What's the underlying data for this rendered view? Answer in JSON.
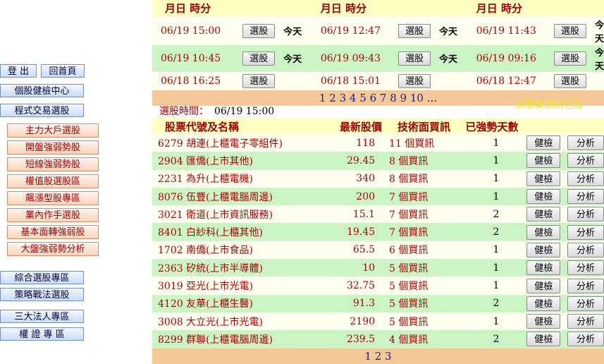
{
  "nav": {
    "top": [
      "登 出",
      "回首頁"
    ],
    "blue1": [
      "個股健檢中心",
      "程式交易選股"
    ],
    "red": [
      "主力大戶選股",
      "開盤強弱勢股",
      "短線強弱勢股",
      "權值股選股區",
      "飆漲型股專區",
      "業內作手選股",
      "基本面轉強弱股",
      "大盤強弱勢分析"
    ],
    "blue2": [
      "綜合選股專區",
      "策略戰法選股",
      "三大法人專區",
      "權 證 專 區"
    ]
  },
  "recent": {
    "header": "月日 時分",
    "pick_label": "選股",
    "rows": [
      [
        {
          "t": "06/19 15:00",
          "today": "今天"
        },
        {
          "t": "06/19 12:47",
          "today": "今天"
        },
        {
          "t": "06/19 11:43",
          "today": "今天"
        }
      ],
      [
        {
          "t": "06/19 10:45",
          "today": "今天"
        },
        {
          "t": "06/19 09:43",
          "today": "今天"
        },
        {
          "t": "06/19 09:16",
          "today": "今天"
        }
      ],
      [
        {
          "t": "06/18 16:25",
          "today": ""
        },
        {
          "t": "06/18 15:01",
          "today": ""
        },
        {
          "t": "06/18 12:47",
          "today": ""
        }
      ]
    ],
    "pages": [
      "1",
      "2",
      "3",
      "4",
      "5",
      "6",
      "7",
      "8",
      "9",
      "10",
      "..."
    ]
  },
  "main": {
    "industry_link": "依產業類別選股",
    "pick_time_label": "選股時間：",
    "pick_time_value": "06/19 15:00",
    "columns": [
      "股票代號及名稱",
      "最新股價",
      "技術面買訊",
      "已強勢天數"
    ],
    "btn_check": "健檢",
    "btn_analyze": "分析",
    "stocks": [
      {
        "name": "6279 胡連(上櫃電子零組件)",
        "price": "118",
        "signal": "11 個買訊",
        "days": "1"
      },
      {
        "name": "2904 匯僑(上市其他)",
        "price": "29.45",
        "signal": "8 個買訊",
        "days": "1"
      },
      {
        "name": "2231 為升(上櫃電機)",
        "price": "340",
        "signal": "8 個買訊",
        "days": "1"
      },
      {
        "name": "8076 伍豐(上櫃電腦周邊)",
        "price": "200",
        "signal": "7 個買訊",
        "days": "1"
      },
      {
        "name": "3021 衛道(上市資訊服務)",
        "price": "15.1",
        "signal": "7 個買訊",
        "days": "2"
      },
      {
        "name": "8401 白紗科(上櫃其他)",
        "price": "19.45",
        "signal": "7 個買訊",
        "days": "2"
      },
      {
        "name": "1702 南僑(上市食品)",
        "price": "65.5",
        "signal": "6 個買訊",
        "days": "1"
      },
      {
        "name": "2363 矽統(上市半導體)",
        "price": "10",
        "signal": "5 個買訊",
        "days": "1"
      },
      {
        "name": "3019 亞光(上市光電)",
        "price": "32.75",
        "signal": "5 個買訊",
        "days": "1"
      },
      {
        "name": "4120 友華(上櫃生醫)",
        "price": "91.3",
        "signal": "5 個買訊",
        "days": "2"
      },
      {
        "name": "3008 大立光(上市光電)",
        "price": "2190",
        "signal": "5 個買訊",
        "days": "1"
      },
      {
        "name": "8299 群聯(上櫃電腦周邊)",
        "price": "239.5",
        "signal": "4 個買訊",
        "days": "2"
      }
    ],
    "pages": [
      "1",
      "2",
      "3"
    ]
  }
}
